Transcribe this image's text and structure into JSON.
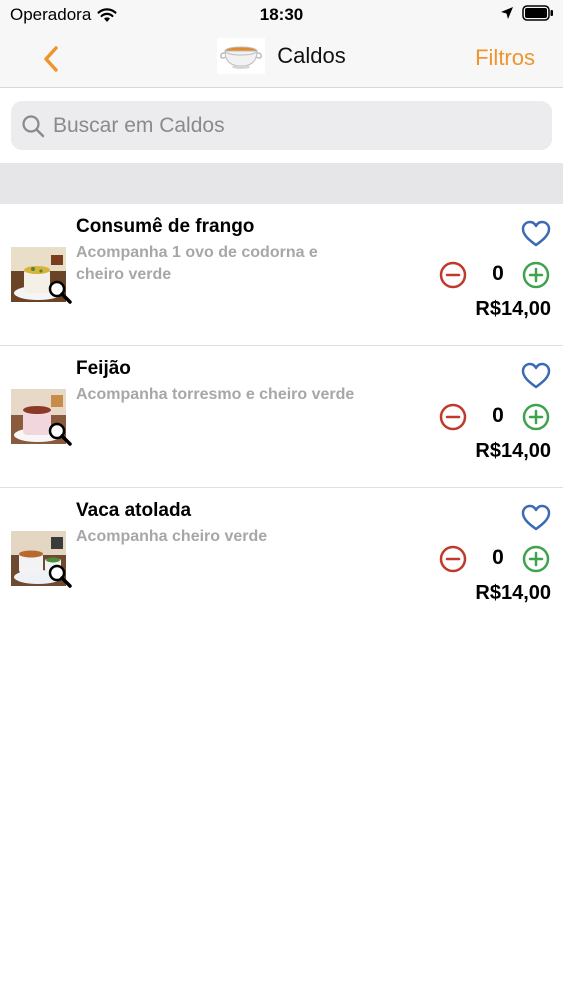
{
  "status_bar": {
    "carrier": "Operadora",
    "time": "18:30"
  },
  "nav": {
    "title": "Caldos",
    "filters_label": "Filtros",
    "accent_color": "#f0952e"
  },
  "search": {
    "placeholder": "Buscar em Caldos",
    "value": ""
  },
  "items": [
    {
      "name": "Consumê de frango",
      "description": "Acompanha 1 ovo de codorna e cheiro verde",
      "quantity": "0",
      "price": "R$14,00"
    },
    {
      "name": "Feijão",
      "description": "Acompanha torresmo e cheiro verde",
      "quantity": "0",
      "price": "R$14,00"
    },
    {
      "name": "Vaca atolada",
      "description": "Acompanha cheiro verde",
      "quantity": "0",
      "price": "R$14,00"
    }
  ],
  "colors": {
    "minus": "#c0392b",
    "plus": "#3fa34d",
    "heart": "#3d6ab5",
    "description": "#a7a7a7"
  }
}
